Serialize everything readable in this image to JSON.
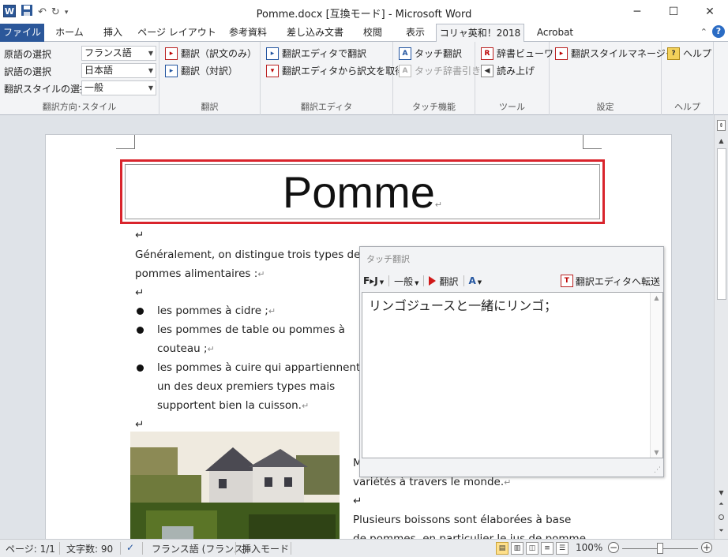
{
  "titlebar": {
    "app_icon": "W",
    "title": "Pomme.docx [互換モード] - Microsoft Word",
    "icons": [
      "word-icon",
      "save-icon",
      "undo-icon",
      "redo-icon",
      "customize-qat-icon",
      "minimize-icon",
      "maximize-icon",
      "close-icon"
    ]
  },
  "tabs": [
    {
      "label": "ファイル"
    },
    {
      "label": "ホーム"
    },
    {
      "label": "挿入"
    },
    {
      "label": "ページ レイアウト"
    },
    {
      "label": "参考資料"
    },
    {
      "label": "差し込み文書"
    },
    {
      "label": "校閲"
    },
    {
      "label": "表示"
    },
    {
      "label": "コリャ英和！2018"
    },
    {
      "label": "Acrobat"
    }
  ],
  "ribbon": {
    "direction": {
      "source_label": "原語の選択",
      "source_value": "フランス語",
      "target_label": "訳語の選択",
      "target_value": "日本語",
      "style_label": "翻訳スタイルの選択",
      "style_value": "一般",
      "group_label": "翻訳方向･スタイル"
    },
    "translate": {
      "item1": "翻訳（訳文のみ）",
      "item2": "翻訳（対訳）",
      "group_label": "翻訳"
    },
    "editor": {
      "item1": "翻訳エディタで翻訳",
      "item2": "翻訳エディタから訳文を取得",
      "group_label": "翻訳エディタ"
    },
    "touch": {
      "item1": "タッチ翻訳",
      "item2": "タッチ辞書引き",
      "group_label": "タッチ機能"
    },
    "tools": {
      "item1": "辞書ビューワ",
      "item2": "読み上げ",
      "group_label": "ツール"
    },
    "settings": {
      "item1": "翻訳スタイルマネージャ",
      "group_label": "設定"
    },
    "help": {
      "item1": "ヘルプ",
      "group_label": "ヘルプ"
    }
  },
  "document": {
    "title": "Pomme",
    "para1_line1": "Généralement, on distingue trois types de",
    "para1_line2": "pommes alimentaires :",
    "bullets": [
      "les pommes à cidre ;",
      "les pommes de table ou pommes à",
      "couteau ;",
      "les pommes à cuire qui appartiennent à",
      "un des deux premiers types mais",
      "supportent bien la cuisson."
    ],
    "right_line1": "M",
    "right_line2": "variétés à travers le monde.",
    "right_line3": "Plusieurs boissons sont élaborées à base",
    "right_line4": "de pommes, en particulier le jus de pomme"
  },
  "touch_panel": {
    "title": "タッチ翻訳",
    "direction": "F▸J",
    "style": "一般",
    "translate_btn": "翻訳",
    "transfer_btn": "翻訳エディタへ転送",
    "result": "リンゴジュースと一緒にリンゴ；"
  },
  "statusbar": {
    "page": "ページ: 1/1",
    "words": "文字数: 90",
    "language": "フランス語 (フランス)",
    "mode": "挿入モード",
    "zoom": "100%"
  }
}
